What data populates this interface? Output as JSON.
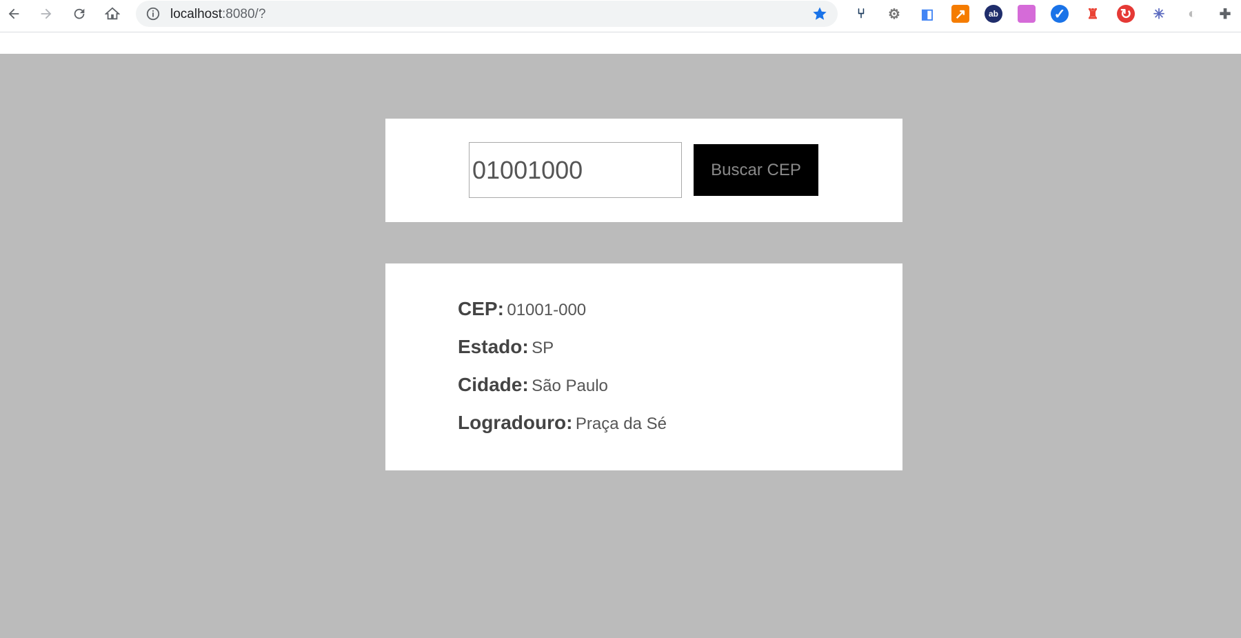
{
  "browser": {
    "url_host": "localhost",
    "url_rest": ":8080/?",
    "extensions": [
      {
        "name": "extension-fork-icon",
        "glyph": "⑂",
        "color": "#1a3a5c",
        "bg": "transparent"
      },
      {
        "name": "extension-gear-icon",
        "glyph": "⚙",
        "color": "#777777",
        "bg": "transparent"
      },
      {
        "name": "extension-tag-icon",
        "glyph": "◧",
        "color": "#4285f4",
        "bg": "transparent"
      },
      {
        "name": "extension-chart-icon",
        "glyph": "↗",
        "color": "#ffffff",
        "bg": "#f57c00"
      },
      {
        "name": "extension-ab-icon",
        "glyph": "ab",
        "color": "#ffffff",
        "bg": "#1f2d6b"
      },
      {
        "name": "extension-gradient-icon",
        "glyph": "",
        "color": "#ffffff",
        "bg": "#d56bd8"
      },
      {
        "name": "extension-check-icon",
        "glyph": "✓",
        "color": "#ffffff",
        "bg": "#1a73e8"
      },
      {
        "name": "extension-lighthouse-icon",
        "glyph": "♜",
        "color": "#ea4335",
        "bg": "transparent"
      },
      {
        "name": "extension-refresh-icon",
        "glyph": "↻",
        "color": "#ffffff",
        "bg": "#e53935"
      },
      {
        "name": "extension-sun-icon",
        "glyph": "✳",
        "color": "#5c6bc0",
        "bg": "transparent"
      },
      {
        "name": "extension-circle-icon",
        "glyph": "◐",
        "color": "#bbbbbb",
        "bg": "transparent"
      },
      {
        "name": "extensions-puzzle-icon",
        "glyph": "✚",
        "color": "#5f6368",
        "bg": "transparent"
      }
    ]
  },
  "search": {
    "input_value": "01001000",
    "button_label": "Buscar CEP"
  },
  "result": {
    "rows": [
      {
        "label": "CEP:",
        "value": "01001-000"
      },
      {
        "label": "Estado:",
        "value": "SP"
      },
      {
        "label": "Cidade:",
        "value": "São Paulo"
      },
      {
        "label": "Logradouro:",
        "value": "Praça da Sé"
      }
    ]
  }
}
